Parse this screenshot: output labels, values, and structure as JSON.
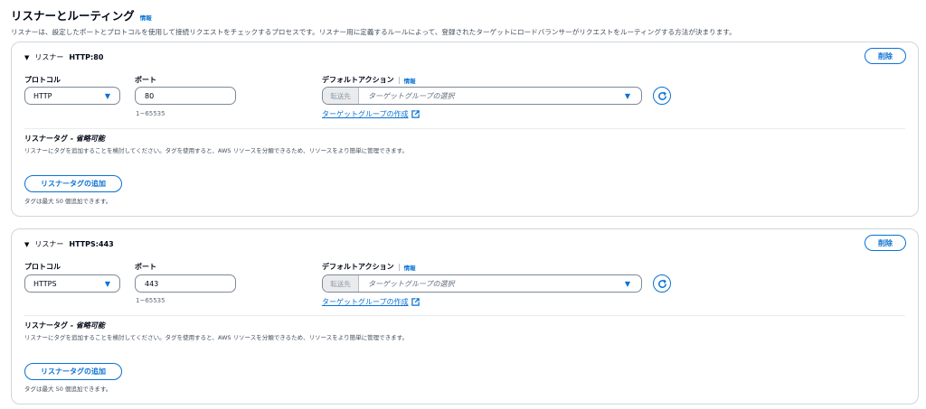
{
  "section": {
    "title": "リスナーとルーティング",
    "info": "情報",
    "description": "リスナーは、設定したポートとプロトコルを使用して接続リクエストをチェックするプロセスです。リスナー用に定義するルールによって、登録されたターゲットにロードバランサーがリクエストをルーティングする方法が決まります。"
  },
  "labels": {
    "listener_prefix": "リスナー",
    "protocol": "プロトコル",
    "port": "ポート",
    "port_hint": "1~65535",
    "default_action": "デフォルトアクション",
    "info": "情報",
    "forward_prefix": "転送先",
    "target_group_placeholder": "ターゲットグループの選択",
    "create_target_group": "ターゲットグループの作成",
    "tags_title": "リスナータグ - ",
    "tags_optional": "省略可能",
    "tags_description": "リスナーにタグを追加することを検討してください。タグを使用すると、AWS リソースを分類できるため、リソースをより簡単に管理できます。",
    "add_tag_button": "リスナータグの追加",
    "tags_limit_note": "タグは最大 50 個追加できます。",
    "delete_button": "削除"
  },
  "listeners": [
    {
      "name": "HTTP:80",
      "protocol": "HTTP",
      "port": "80"
    },
    {
      "name": "HTTPS:443",
      "protocol": "HTTPS",
      "port": "443"
    }
  ],
  "colors": {
    "accent": "#0972d3",
    "border": "#d1d5db",
    "muted_text": "#414d5c"
  }
}
